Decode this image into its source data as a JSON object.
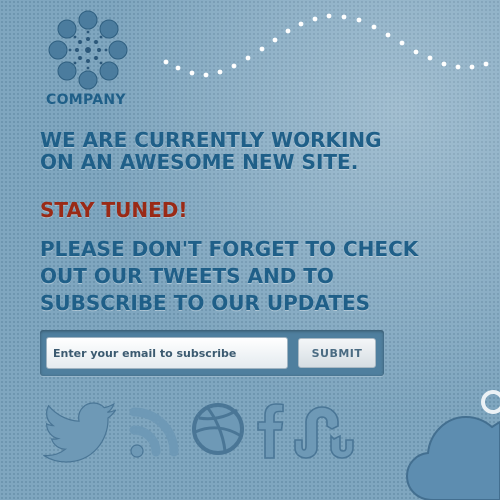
{
  "brand": {
    "name": "COMPANY",
    "logo_icon": "flower-logo-icon"
  },
  "hero": {
    "headline_line1": "WE ARE CURRENTLY WORKING",
    "headline_line2": "ON AN AWESOME NEW SITE.",
    "tagline": "STAY TUNED!",
    "reminder_line1": "PLEASE DON'T FORGET TO CHECK",
    "reminder_line2": "OUT OUR TWEETS AND TO",
    "reminder_line3": "SUBSCRIBE TO OUR UPDATES"
  },
  "subscribe": {
    "email_placeholder": "Enter your email to subscribe",
    "email_value": "",
    "submit_label": "SUBMIT"
  },
  "social": [
    "twitter-icon",
    "rss-icon",
    "dribbble-icon",
    "facebook-icon",
    "stumbleupon-icon"
  ],
  "colors": {
    "background": "#7fa6bf",
    "headline": "#1f5f88",
    "tagline": "#9a2a16",
    "form_box": "#4f7f9e"
  }
}
